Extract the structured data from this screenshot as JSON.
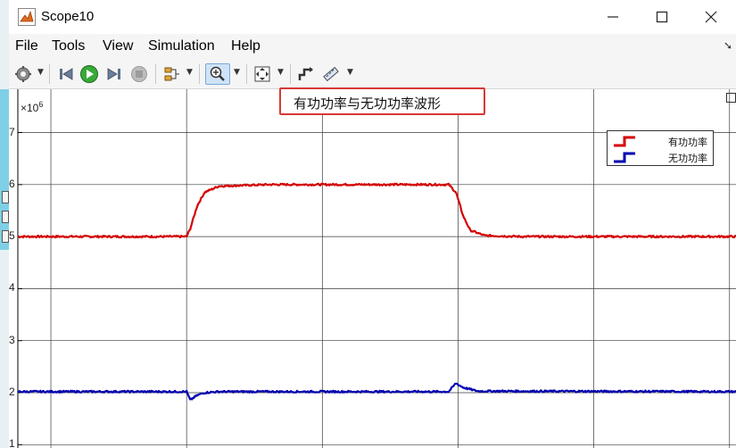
{
  "window": {
    "title": "Scope10",
    "minimize_icon": "—",
    "maximize_icon": "☐",
    "close_icon": "✕"
  },
  "menu": {
    "file": "File",
    "tools": "Tools",
    "view": "View",
    "simulation": "Simulation",
    "help": "Help"
  },
  "toolbar": {
    "icons": [
      "gear-icon",
      "step-back-icon",
      "run-icon",
      "step-forward-icon",
      "stop-icon",
      "signal-selector-icon",
      "zoom-in-icon",
      "fit-to-view-icon",
      "highlight-block-icon",
      "measurement-icon"
    ]
  },
  "plot": {
    "title": "有功功率与无功功率波形",
    "y_exponent_base": "×10",
    "y_exponent_power": "6"
  },
  "colors": {
    "active_power": "#d40000",
    "reactive_power": "#0000b0",
    "title_box_border": "#d93838",
    "grid": "#202020"
  },
  "chart_data": {
    "type": "line",
    "title": "有功功率与无功功率波形",
    "ylabel": "",
    "xlabel": "",
    "y_multiplier": 1000000,
    "y_ticks": [
      1,
      2,
      3,
      4,
      5,
      6,
      7
    ],
    "ylim": [
      1.0,
      7.3
    ],
    "xlim": [
      0,
      1
    ],
    "grid": true,
    "legend_position": "top-right",
    "series": [
      {
        "name": "有功功率",
        "color": "#d40000",
        "points": [
          [
            0,
            5.0
          ],
          [
            0.235,
            5.0
          ],
          [
            0.24,
            5.15
          ],
          [
            0.25,
            5.6
          ],
          [
            0.26,
            5.85
          ],
          [
            0.28,
            5.97
          ],
          [
            0.35,
            6.0
          ],
          [
            0.5,
            6.0
          ],
          [
            0.6,
            6.0
          ],
          [
            0.61,
            5.85
          ],
          [
            0.62,
            5.4
          ],
          [
            0.63,
            5.12
          ],
          [
            0.65,
            5.02
          ],
          [
            0.7,
            5.0
          ],
          [
            1.0,
            5.0
          ]
        ]
      },
      {
        "name": "无功功率",
        "color": "#0000b0",
        "points": [
          [
            0,
            2.02
          ],
          [
            0.235,
            2.02
          ],
          [
            0.24,
            1.86
          ],
          [
            0.25,
            1.95
          ],
          [
            0.26,
            2.0
          ],
          [
            0.28,
            2.02
          ],
          [
            0.6,
            2.02
          ],
          [
            0.61,
            2.18
          ],
          [
            0.62,
            2.1
          ],
          [
            0.64,
            2.03
          ],
          [
            1.0,
            2.02
          ]
        ]
      }
    ]
  },
  "legend": {
    "entries": [
      "有功功率",
      "无功功率"
    ]
  }
}
